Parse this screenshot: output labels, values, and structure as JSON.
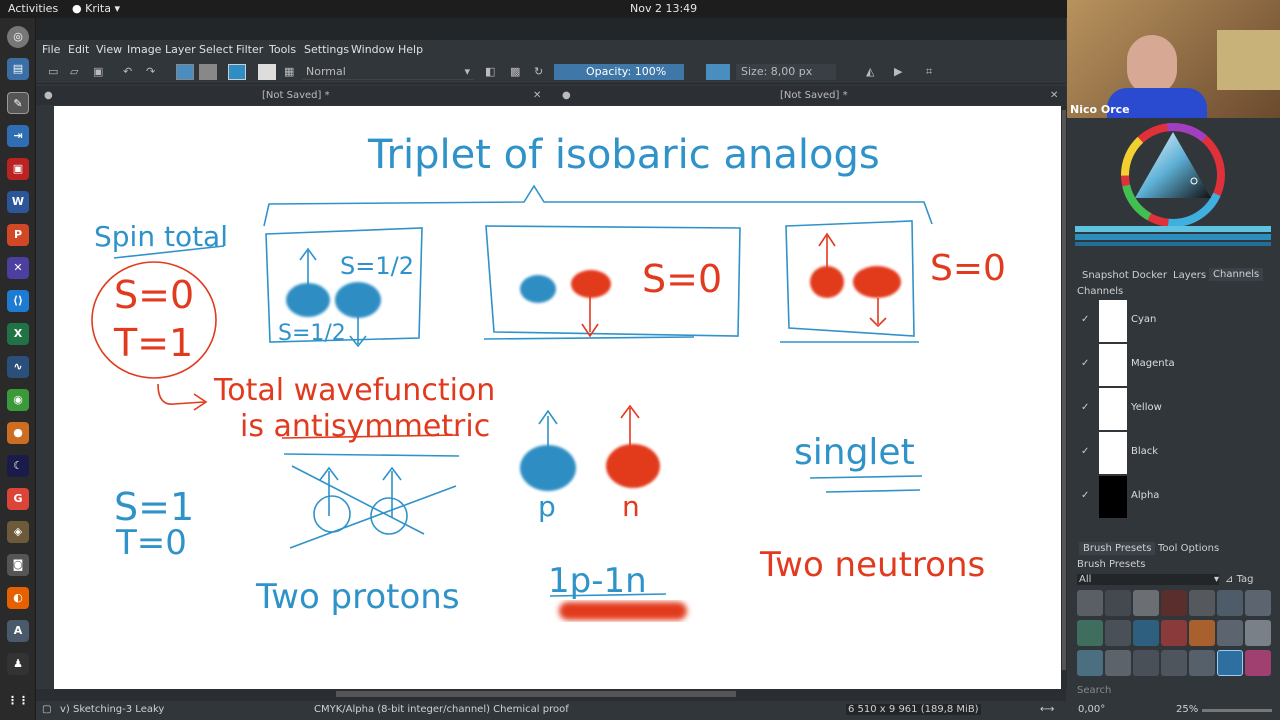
{
  "topbar": {
    "activities": "Activities",
    "app": "Krita ▾",
    "clock": "Nov 2  13:49"
  },
  "menu": [
    "File",
    "Edit",
    "View",
    "Image",
    "Layer",
    "Select",
    "Filter",
    "Tools",
    "Settings",
    "Window",
    "Help"
  ],
  "toolbar": {
    "blend_mode": "Normal",
    "opacity": "Opacity: 100%",
    "size": "Size: 8,00 px"
  },
  "tabs": [
    {
      "label": "[Not Saved]  *"
    },
    {
      "label": "[Not Saved]  *"
    }
  ],
  "webcam": {
    "name": "Nico Orce"
  },
  "dockers": {
    "tab1": "Snapshot Docker",
    "tab2": "Layers",
    "tab3": "Channels",
    "channels_title": "Channels",
    "channels": [
      "Cyan",
      "Magenta",
      "Yellow",
      "Black",
      "Alpha"
    ],
    "brush_tab1": "Brush Presets",
    "brush_tab2": "Tool Options",
    "brush_title": "Brush Presets",
    "brush_filter": "All",
    "tag": "Tag",
    "search": "Search"
  },
  "status": {
    "brush": "v) Sketching-3 Leaky",
    "colorspace": "CMYK/Alpha (8-bit integer/channel)  Chemical proof",
    "dims": "6 510 x 9 961 (189,8 MiB)",
    "angle": "0,00°",
    "zoom": "25%"
  },
  "canvas": {
    "title": "Triplet of isobaric analogs",
    "spin_total": "Spin total",
    "s0": "S=0",
    "t1": "T=1",
    "total_wf_1": "Total wavefunction",
    "total_wf_2": "is antisymmetric",
    "s_half_top": "S=1/2",
    "s_half_bottom": "S=1/2",
    "s_zero_mid": "S=0",
    "s_zero_right": "S=0",
    "s1": "S=1",
    "t0": "T=0",
    "singlet": "singlet",
    "p": "p",
    "n": "n",
    "two_protons": "Two protons",
    "one_p_one_n": "1p-1n",
    "two_neutrons": "Two neutrons"
  },
  "colors": {
    "blue": "#2e8ec4",
    "red": "#e23a1e",
    "ink_blue": "#2f93c9"
  }
}
